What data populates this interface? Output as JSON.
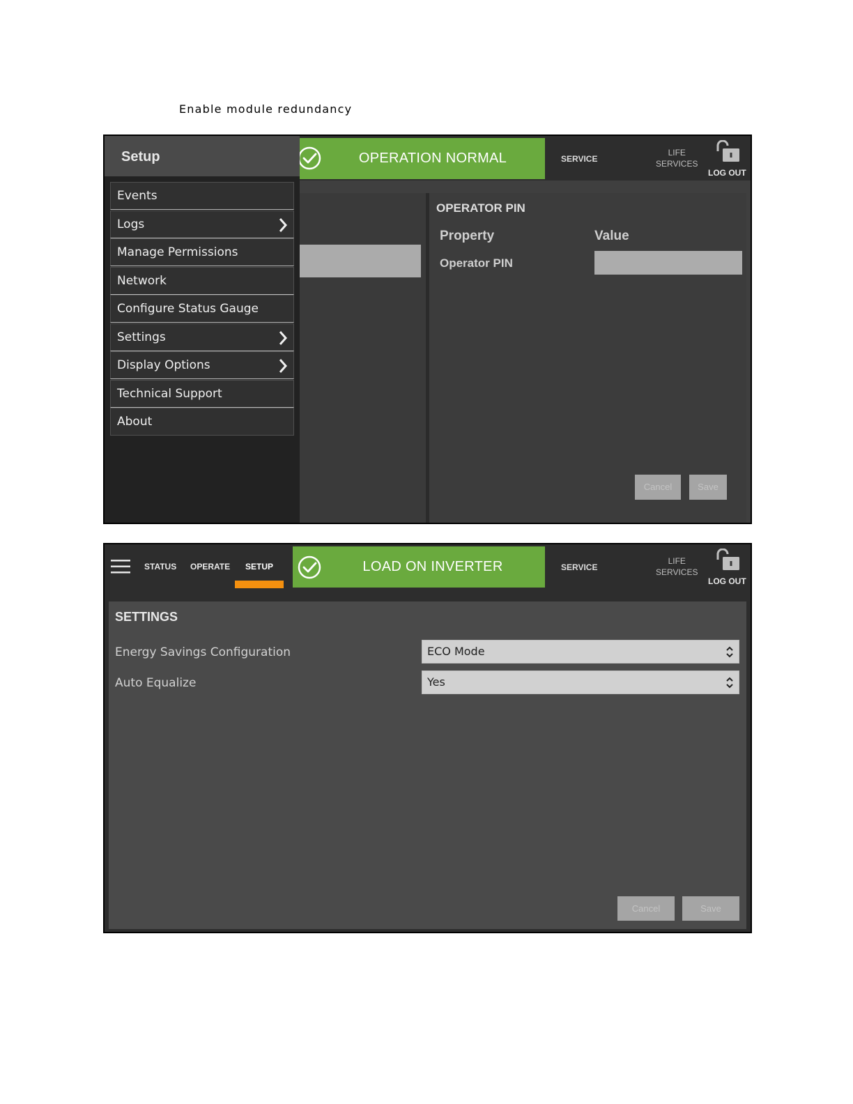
{
  "document": {
    "heading": "Enable module redundancy"
  },
  "screen1": {
    "drawer": {
      "title": "Setup",
      "items": [
        {
          "label": "Events",
          "has_submenu": false
        },
        {
          "label": "Logs",
          "has_submenu": true
        },
        {
          "label": "Manage Permissions",
          "has_submenu": false
        },
        {
          "label": "Network",
          "has_submenu": false
        },
        {
          "label": "Configure Status Gauge",
          "has_submenu": false
        },
        {
          "label": "Settings",
          "has_submenu": true
        },
        {
          "label": "Display Options",
          "has_submenu": true
        },
        {
          "label": "Technical Support",
          "has_submenu": false
        },
        {
          "label": "About",
          "has_submenu": false
        }
      ]
    },
    "status_banner": {
      "text": "OPERATION NORMAL",
      "icon": "check-circle-icon"
    },
    "header": {
      "service": "SERVICE",
      "life_services_line1": "LIFE",
      "life_services_line2": "SERVICES",
      "logout": "LOG OUT",
      "lock_icon": "unlocked-padlock-icon"
    },
    "panel": {
      "title": "OPERATOR PIN",
      "property_header": "Property",
      "value_header": "Value",
      "row_label": "Operator PIN",
      "row_value": "",
      "cancel_label": "Cancel",
      "save_label": "Save"
    }
  },
  "screen2": {
    "nav": {
      "menu_icon": "hamburger-icon",
      "tabs": [
        "STATUS",
        "OPERATE",
        "SETUP"
      ],
      "active_tab": "SETUP"
    },
    "status_banner": {
      "text": "LOAD ON INVERTER",
      "icon": "check-circle-icon"
    },
    "header": {
      "service": "SERVICE",
      "life_services_line1": "LIFE",
      "life_services_line2": "SERVICES",
      "logout": "LOG OUT",
      "lock_icon": "unlocked-padlock-icon"
    },
    "panel": {
      "title": "SETTINGS",
      "settings": [
        {
          "label": "Energy Savings Configuration",
          "value": "ECO Mode"
        },
        {
          "label": "Auto Equalize",
          "value": "Yes"
        }
      ],
      "cancel_label": "Cancel",
      "save_label": "Save"
    }
  },
  "colors": {
    "status_green": "#6aaa3e",
    "active_tab_orange": "#f4900f",
    "topbar_dark": "#2d2d2d",
    "panel_gray": "#4a4a4a"
  }
}
